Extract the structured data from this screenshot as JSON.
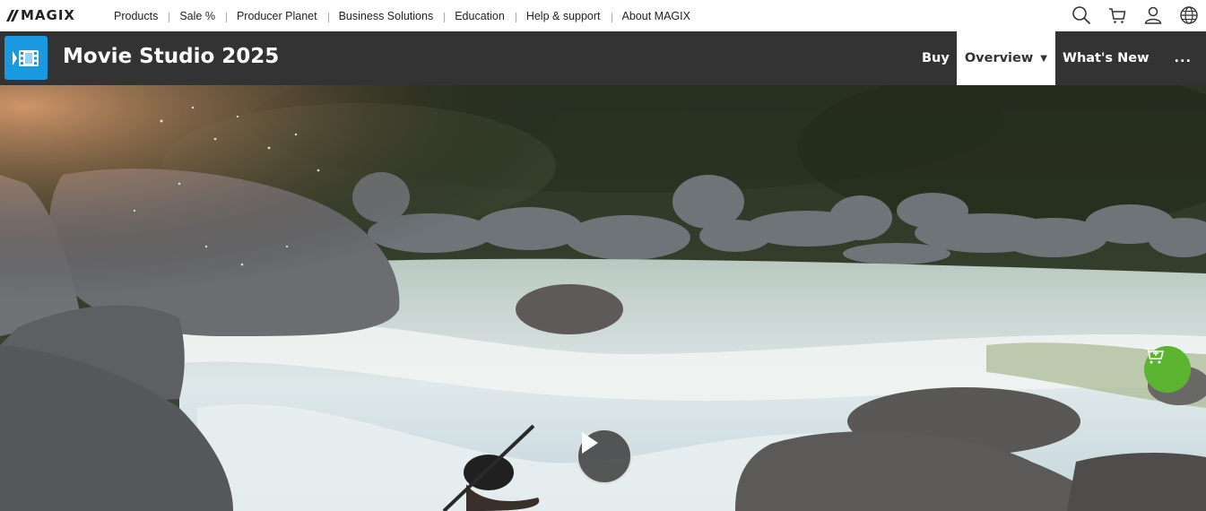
{
  "brand": {
    "logo_text": "MAGIX"
  },
  "top_nav": {
    "items": [
      "Products",
      "Sale %",
      "Producer Planet",
      "Business Solutions",
      "Education",
      "Help & support",
      "About MAGIX"
    ]
  },
  "top_icons": [
    "search-icon",
    "cart-icon",
    "user-icon",
    "globe-icon"
  ],
  "product": {
    "title": "Movie Studio 2025",
    "nav": {
      "buy": "Buy",
      "overview": "Overview",
      "whats_new": "What's New",
      "more": "..."
    }
  },
  "colors": {
    "product_bar": "#333333",
    "product_icon": "#1a98e0",
    "cart_fab": "#5cb531"
  }
}
